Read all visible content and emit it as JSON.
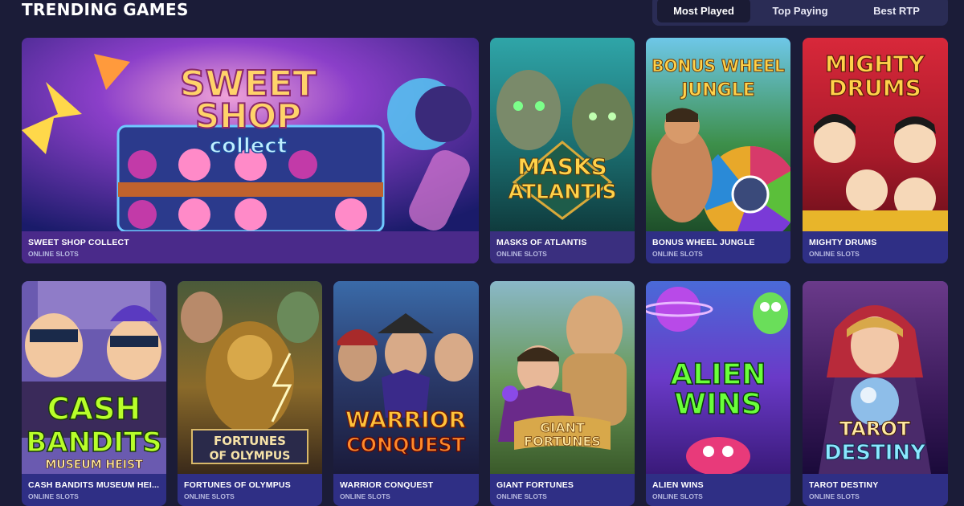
{
  "section": {
    "title": "TRENDING GAMES"
  },
  "filters": {
    "tabs": [
      "Most Played",
      "Top Paying",
      "Best RTP"
    ],
    "active": "Most Played"
  },
  "games": [
    {
      "name": "SWEET SHOP COLLECT",
      "category": "ONLINE SLOTS",
      "logo": [
        "SWEET",
        "SHOP",
        "collect"
      ]
    },
    {
      "name": "MASKS OF ATLANTIS",
      "category": "ONLINE SLOTS",
      "logo": [
        "MASKS",
        "ATLANTIS"
      ]
    },
    {
      "name": "BONUS WHEEL JUNGLE",
      "category": "ONLINE SLOTS",
      "logo": [
        "BONUS WHEEL",
        "JUNGLE"
      ]
    },
    {
      "name": "MIGHTY DRUMS",
      "category": "ONLINE SLOTS",
      "logo": [
        "MIGHTY",
        "DRUMS"
      ]
    },
    {
      "name": "CASH BANDITS MUSEUM HEI...",
      "category": "ONLINE SLOTS",
      "logo": [
        "CASH",
        "BANDITS",
        "MUSEUM HEIST"
      ]
    },
    {
      "name": "FORTUNES OF OLYMPUS",
      "category": "ONLINE SLOTS",
      "logo": [
        "FORTUNES",
        "OF OLYMPUS"
      ]
    },
    {
      "name": "WARRIOR CONQUEST",
      "category": "ONLINE SLOTS",
      "logo": [
        "WARRIOR",
        "CONQUEST"
      ]
    },
    {
      "name": "GIANT FORTUNES",
      "category": "ONLINE SLOTS",
      "logo": [
        "GIANT",
        "FORTUNES"
      ]
    },
    {
      "name": "ALIEN WINS",
      "category": "ONLINE SLOTS",
      "logo": [
        "ALIEN",
        "WINS"
      ]
    },
    {
      "name": "TAROT DESTINY",
      "category": "ONLINE SLOTS",
      "logo": [
        "TAROT",
        "DESTINY"
      ]
    }
  ]
}
